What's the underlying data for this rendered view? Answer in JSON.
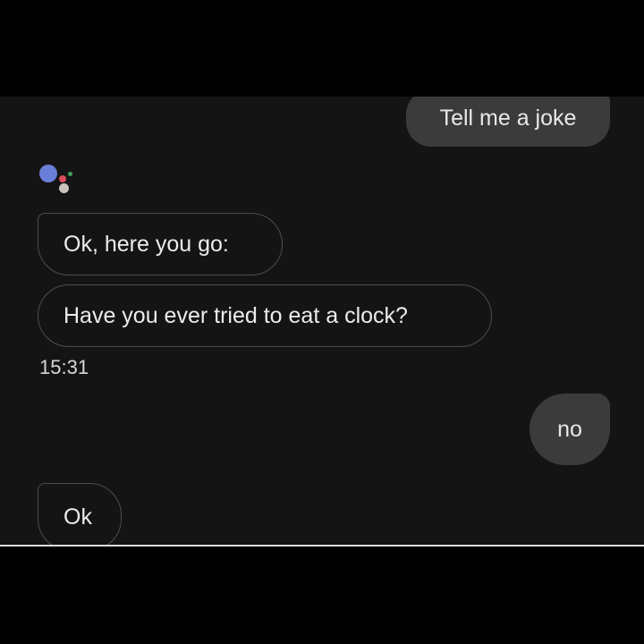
{
  "conversation": {
    "messages": [
      {
        "sender": "user",
        "text": "Tell me a joke"
      },
      {
        "sender": "assistant",
        "text": "Ok, here you go:"
      },
      {
        "sender": "assistant",
        "text": "Have you ever tried to eat a clock?"
      },
      {
        "sender": "user",
        "text": "no"
      },
      {
        "sender": "assistant",
        "text": "Ok"
      }
    ],
    "timestamp": "15:31"
  },
  "assistant_logo": {
    "icon": "google-assistant-icon",
    "colors": [
      "#6a7fd8",
      "#d94c5a",
      "#e9b84a",
      "#3fa05b"
    ]
  },
  "colors": {
    "background": "#141414",
    "user_bubble": "#3b3b3b",
    "assistant_border": "#4d4d4d",
    "text": "#ececec"
  }
}
